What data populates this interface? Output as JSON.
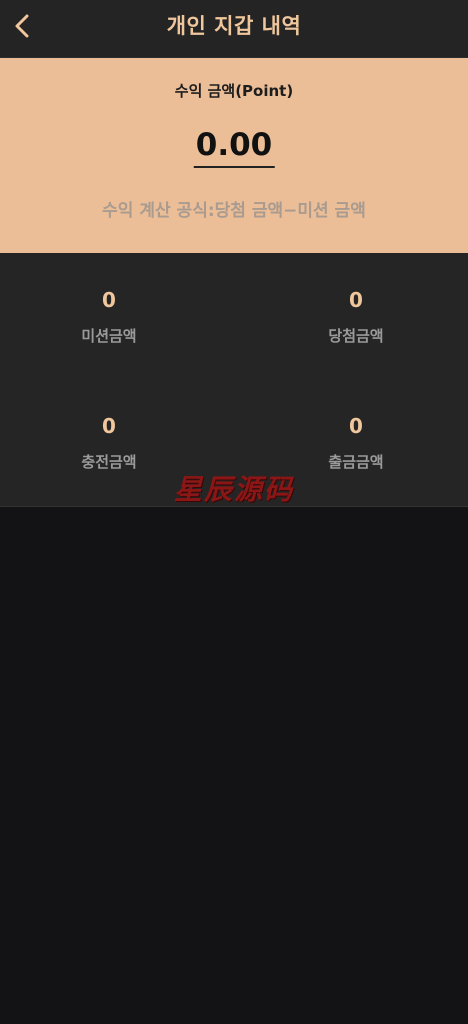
{
  "header": {
    "title": "개인 지갑 내역",
    "back_icon": "chevron-left-icon"
  },
  "earnings": {
    "label": "수익 금액(Point)",
    "amount": "0.00",
    "formula": "수익 계산 공식:당첨 금액−미션 금액"
  },
  "stats": {
    "mission": {
      "value": "0",
      "label": "미션금액"
    },
    "win": {
      "value": "0",
      "label": "당첨금액"
    },
    "charge": {
      "value": "0",
      "label": "충전금액"
    },
    "withdraw": {
      "value": "0",
      "label": "출금금액"
    }
  },
  "watermark": "星辰源码",
  "colors": {
    "accent": "#f0c79d",
    "card_bg": "#ecbe97",
    "header_bg": "#242424",
    "panel_bg": "#252525",
    "page_bg": "#131315"
  }
}
